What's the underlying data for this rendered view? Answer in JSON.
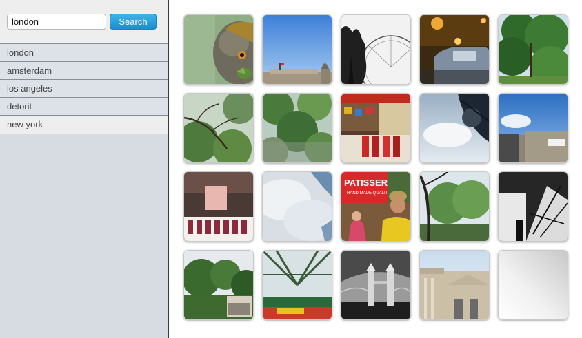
{
  "search": {
    "value": "london",
    "button_label": "Search"
  },
  "cities": [
    {
      "label": "london"
    },
    {
      "label": "amsterdam"
    },
    {
      "label": "los angeles"
    },
    {
      "label": "detorit"
    },
    {
      "label": "new york"
    }
  ],
  "banner_text": "PATISSERIE",
  "banner_subtext": "HAND MADE QUALITY"
}
